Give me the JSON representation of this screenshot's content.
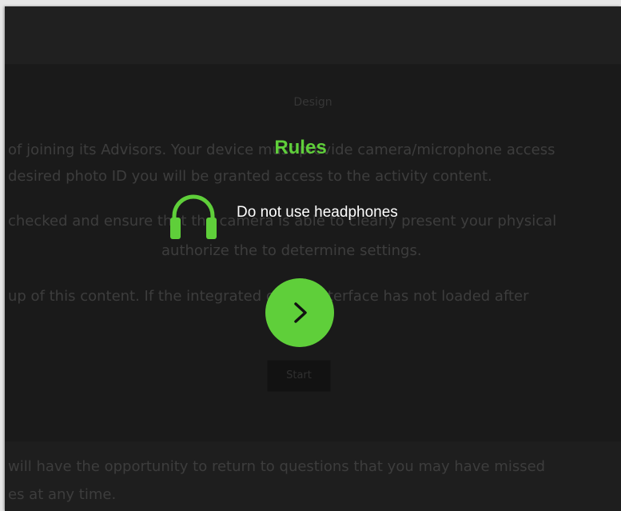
{
  "background": {
    "heading": "Design",
    "lines": [
      "of joining its Advisors. Your device must provide camera/microphone access",
      "desired photo ID you will be granted access to the activity content.",
      "checked and ensure that the camera is able to clearly present your physical",
      "authorize the to determine settings.",
      "up of this content. If the integrated online interface has not loaded after",
      "will have the opportunity to return to questions that you may have missed",
      "es at any time."
    ],
    "button_label": "Start"
  },
  "modal": {
    "title": "Rules",
    "rules": [
      {
        "icon": "headphones-icon",
        "text": "Do not use headphones"
      }
    ],
    "next_icon": "chevron-right-icon"
  },
  "colors": {
    "accent": "#5fcf3a",
    "overlay_background": "#1a1a1a",
    "rule_text": "#ffffff"
  }
}
